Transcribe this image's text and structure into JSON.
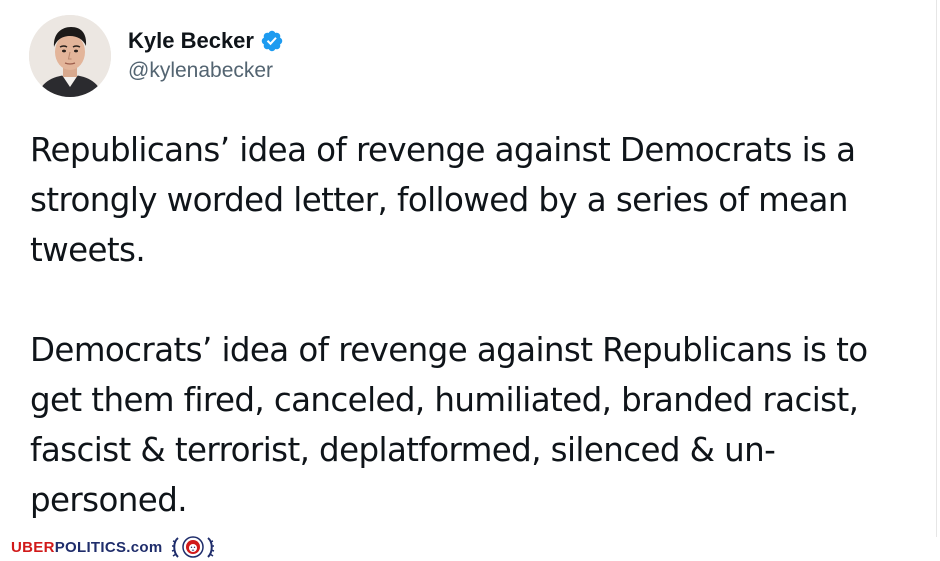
{
  "tweet": {
    "author": {
      "display_name": "Kyle Becker",
      "handle": "@kylenabecker",
      "verified": true,
      "avatar_icon": "profile-photo"
    },
    "paragraphs": [
      "Republicans’ idea of revenge against Democrats is a\nstrongly worded letter, followed by a series of mean\ntweets.",
      "Democrats’ idea of revenge against Republicans is to\nget them fired, canceled, humiliated, branded racist,\nfascist & terrorist, deplatformed, silenced & un-\npersoned."
    ]
  },
  "watermark": {
    "uber": "UBER",
    "politics": "POLITICS.com",
    "logo_icon": "lion-crest-logo"
  },
  "colors": {
    "text": "#0f1419",
    "handle": "#536471",
    "verified_badge": "#1d9bf0",
    "watermark_red": "#d11a1a",
    "watermark_navy": "#1f2d6b"
  }
}
